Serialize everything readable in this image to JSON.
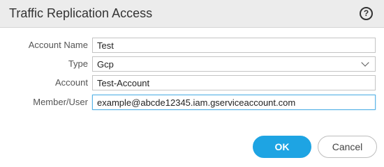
{
  "dialog": {
    "title": "Traffic Replication Access",
    "help_icon_glyph": "?"
  },
  "form": {
    "account_name": {
      "label": "Account Name",
      "value": "Test"
    },
    "type": {
      "label": "Type",
      "value": "Gcp"
    },
    "account": {
      "label": "Account",
      "value": "Test-Account"
    },
    "member_user": {
      "label": "Member/User",
      "value": "example@abcde12345.iam.gserviceaccount.com"
    }
  },
  "buttons": {
    "ok_label": "OK",
    "cancel_label": "Cancel"
  },
  "colors": {
    "header_bg": "#ececec",
    "accent": "#1ea4e3",
    "focus_border": "#5ab4e6"
  }
}
